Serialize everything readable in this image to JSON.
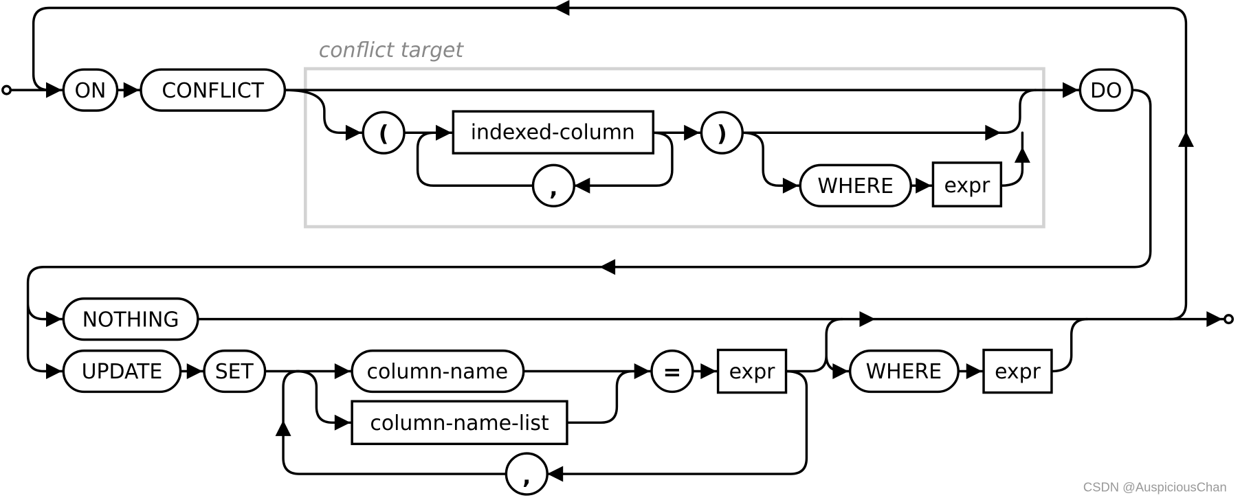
{
  "diagram": {
    "group_label": "conflict target",
    "nodes": {
      "on": "ON",
      "conflict": "CONFLICT",
      "lparen": "(",
      "indexed_column": "indexed-column",
      "comma1": ",",
      "rparen": ")",
      "where1": "WHERE",
      "expr1": "expr",
      "do": "DO",
      "nothing": "NOTHING",
      "update": "UPDATE",
      "set": "SET",
      "column_name": "column-name",
      "column_name_list": "column-name-list",
      "equals": "=",
      "expr2": "expr",
      "comma2": ",",
      "where2": "WHERE",
      "expr3": "expr"
    }
  },
  "watermark": "CSDN @AuspiciousChan"
}
